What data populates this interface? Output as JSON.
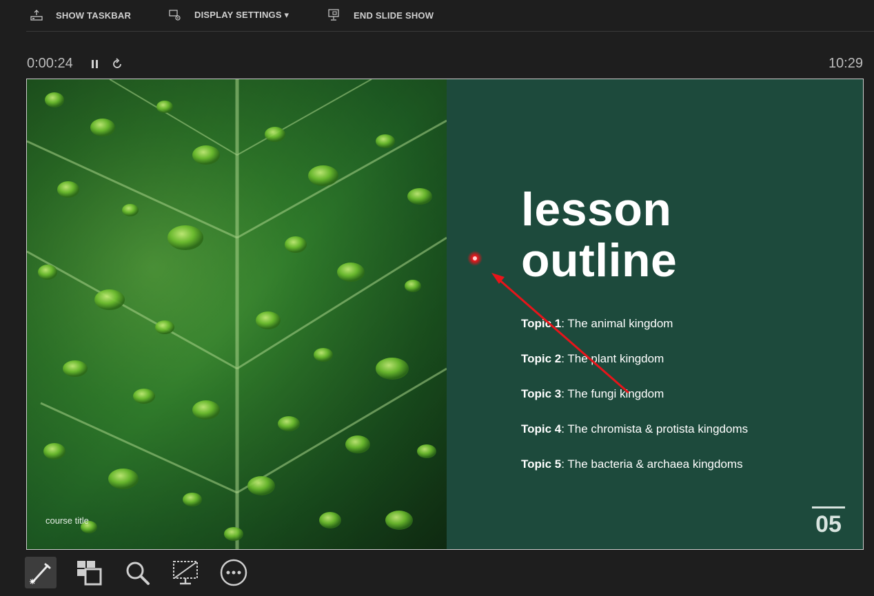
{
  "toolbar": {
    "show_taskbar": "SHOW TASKBAR",
    "display_settings": "DISPLAY SETTINGS ▾",
    "end_slide_show": "END SLIDE SHOW"
  },
  "timer": {
    "elapsed": "0:00:24",
    "clock": "10:29"
  },
  "slide": {
    "course_title": "course title",
    "title_line1": "lesson",
    "title_line2": "outline",
    "topics": [
      {
        "label": "Topic 1",
        "text": ": The animal kingdom"
      },
      {
        "label": "Topic 2",
        "text": ": The plant kingdom"
      },
      {
        "label": "Topic 3",
        "text": ": The fungi kingdom"
      },
      {
        "label": "Topic 4",
        "text": ": The chromista & protista kingdoms"
      },
      {
        "label": "Topic 5",
        "text": ": The bacteria & archaea kingdoms"
      }
    ],
    "page_number": "05",
    "colors": {
      "panel": "#1d4a3c",
      "leaf": "#2f7a2a",
      "annotation": "#e8141a"
    }
  },
  "icons": {
    "toolbar": [
      "taskbar-icon",
      "display-settings-icon",
      "end-show-icon"
    ],
    "controls": [
      "pause-icon",
      "restart-icon"
    ],
    "bottom": [
      "pen-laser-icon",
      "see-all-slides-icon",
      "zoom-icon",
      "black-screen-icon",
      "more-options-icon"
    ]
  }
}
